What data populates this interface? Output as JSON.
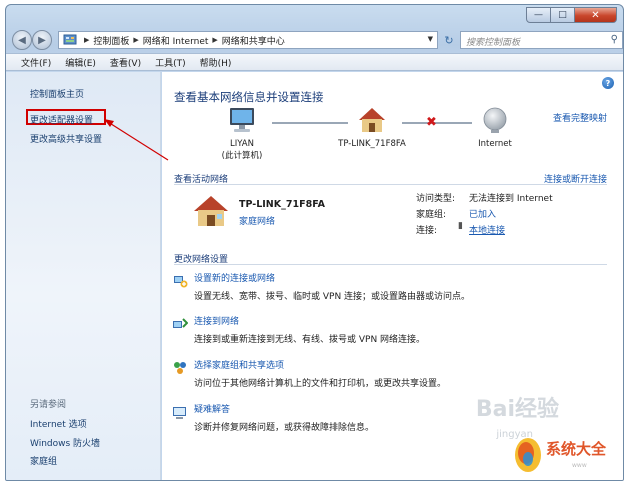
{
  "window": {
    "minimize_glyph": "—",
    "maximize_glyph": "□",
    "close_glyph": "✕"
  },
  "address": {
    "crumbs": [
      "控制面板",
      "网络和 Internet",
      "网络和共享中心"
    ],
    "search_placeholder": "搜索控制面板"
  },
  "menu": {
    "file": "文件(F)",
    "edit": "编辑(E)",
    "view": "查看(V)",
    "tools": "工具(T)",
    "help": "帮助(H)"
  },
  "sidebar": {
    "home": "控制面板主页",
    "change_adapter": "更改适配器设置",
    "change_advanced": "更改高级共享设置",
    "see_also": "另请参阅",
    "internet_options": "Internet 选项",
    "firewall": "Windows 防火墙",
    "homegroup": "家庭组"
  },
  "main": {
    "title": "查看基本网络信息并设置连接",
    "view_full_map": "查看完整映射",
    "nodes": {
      "pc_name": "LIYAN",
      "pc_sub": "(此计算机)",
      "router": "TP-LINK_71F8FA",
      "internet": "Internet"
    },
    "active_section": "查看活动网络",
    "connect_disconnect": "连接或断开连接",
    "active": {
      "name": "TP-LINK_71F8FA",
      "type": "家庭网络",
      "access_label": "访问类型:",
      "access_value": "无法连接到 Internet",
      "homegroup_label": "家庭组:",
      "homegroup_value": "已加入",
      "connection_label": "连接:",
      "connection_value": "本地连接"
    },
    "change_section": "更改网络设置",
    "tasks": [
      {
        "link": "设置新的连接或网络",
        "desc": "设置无线、宽带、拨号、临时或 VPN 连接；或设置路由器或访问点。"
      },
      {
        "link": "连接到网络",
        "desc": "连接到或重新连接到无线、有线、拨号或 VPN 网络连接。"
      },
      {
        "link": "选择家庭组和共享选项",
        "desc": "访问位于其他网络计算机上的文件和打印机，或更改共享设置。"
      },
      {
        "link": "疑难解答",
        "desc": "诊断并修复网络问题，或获得故障排除信息。"
      }
    ]
  },
  "watermark": {
    "baidu": "Bai经验",
    "jingyan": "jingyan",
    "logo_text": "系统大全",
    "logo_url": "www"
  },
  "colors": {
    "link": "#1a59b0",
    "title": "#1c3e7a",
    "highlight_box": "#d10000",
    "disconnect_x": "#d0191b"
  }
}
